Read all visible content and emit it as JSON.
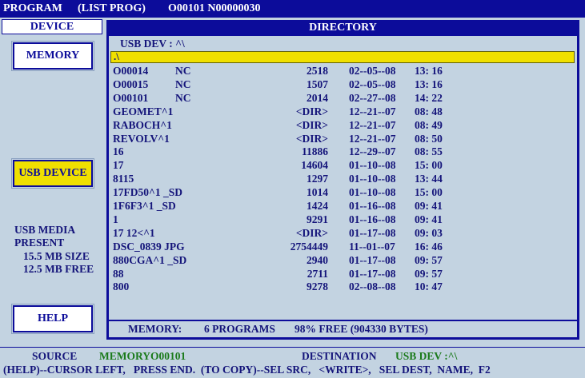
{
  "header": {
    "mode": "PROGRAM",
    "screen": "(LIST PROG)",
    "program_ids": "O00101 N00000030"
  },
  "sidebar": {
    "device_tab": "DEVICE",
    "memory_button": "MEMORY",
    "usb_device_button": "USB DEVICE",
    "usb_media_line1": "USB MEDIA",
    "usb_media_line2": "PRESENT",
    "usb_size": "15.5 MB SIZE",
    "usb_free": "12.5 MB FREE",
    "help_button": "HELP"
  },
  "directory": {
    "title": "DIRECTORY",
    "path": "USB DEV : ^\\",
    "selected_entry": ".\\",
    "entries": [
      {
        "name": "O00014",
        "type": "NC",
        "size": "2518",
        "date": "02--05--08",
        "time": "13: 16"
      },
      {
        "name": "O00015",
        "type": "NC",
        "size": "1507",
        "date": "02--05--08",
        "time": "13: 16"
      },
      {
        "name": "O00101",
        "type": "NC",
        "size": "2014",
        "date": "02--27--08",
        "time": "14: 22"
      },
      {
        "name": "GEOMET^1",
        "type": "",
        "size": "<DIR>",
        "date": "12--21--07",
        "time": "08: 48"
      },
      {
        "name": "RABOCH^1",
        "type": "",
        "size": "<DIR>",
        "date": "12--21--07",
        "time": "08: 49"
      },
      {
        "name": "REVOLV^1",
        "type": "",
        "size": "<DIR>",
        "date": "12--21--07",
        "time": "08: 50"
      },
      {
        "name": "16",
        "type": "",
        "size": "11886",
        "date": "12--29--07",
        "time": "08: 55"
      },
      {
        "name": "17",
        "type": "",
        "size": "14604",
        "date": "01--10--08",
        "time": "15: 00"
      },
      {
        "name": "8115",
        "type": "",
        "size": "1297",
        "date": "01--10--08",
        "time": "13: 44"
      },
      {
        "name": "17FD50^1 _SD",
        "type": "",
        "size": "1014",
        "date": "01--10--08",
        "time": "15: 00"
      },
      {
        "name": "1F6F3^1 _SD",
        "type": "",
        "size": "1424",
        "date": "01--16--08",
        "time": "09: 41"
      },
      {
        "name": "1",
        "type": "",
        "size": "9291",
        "date": "01--16--08",
        "time": "09: 41"
      },
      {
        "name": "17 12<^1",
        "type": "",
        "size": "<DIR>",
        "date": "01--17--08",
        "time": "09: 03"
      },
      {
        "name": "DSC_0839 JPG",
        "type": "",
        "size": "2754449",
        "date": "11--01--07",
        "time": "16: 46"
      },
      {
        "name": "880CGA^1 _SD",
        "type": "",
        "size": "2940",
        "date": "01--17--08",
        "time": "09: 57"
      },
      {
        "name": "88",
        "type": "",
        "size": "2711",
        "date": "01--17--08",
        "time": "09: 57"
      },
      {
        "name": "800",
        "type": "",
        "size": "9278",
        "date": "02--08--08",
        "time": "10: 47"
      }
    ]
  },
  "memory_status": {
    "label": "MEMORY:",
    "programs": "6 PROGRAMS",
    "free": "98% FREE (904330 BYTES)"
  },
  "footer": {
    "source_label": "SOURCE",
    "source_value": "MEMORYO00101",
    "destination_label": "DESTINATION",
    "destination_value": "USB DEV :^\\",
    "help_text": "(HELP)--CURSOR LEFT,   PRESS END.  (TO COPY)--SEL SRC,   <WRITE>,   SEL DEST,  NAME,  F2"
  },
  "colors": {
    "title_bar": "#0c0c9a",
    "background": "#c3d3e1",
    "highlight": "#f0e000",
    "text": "#14147a",
    "footer_value": "#1a7a1a"
  }
}
